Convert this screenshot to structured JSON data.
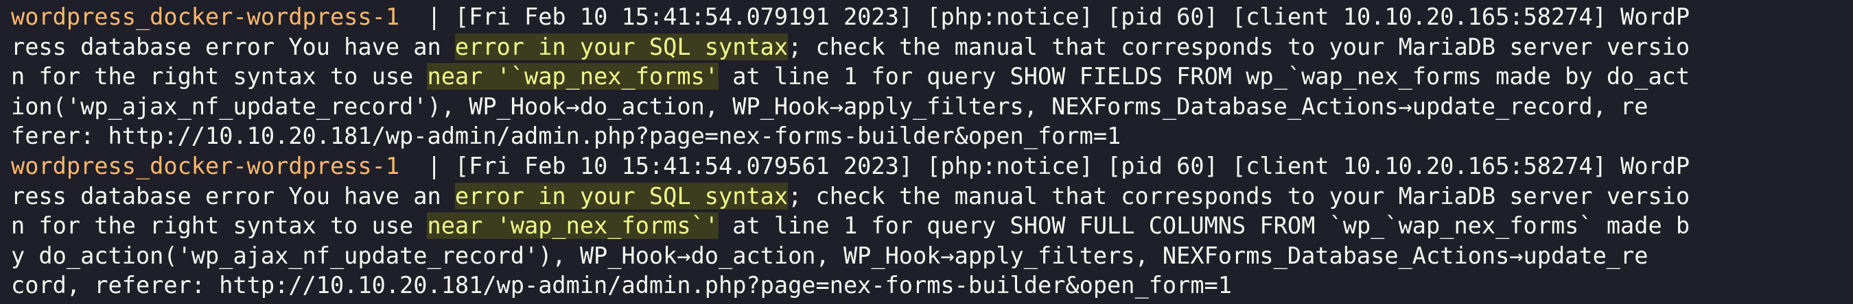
{
  "terminal": {
    "background": "#1e1f29",
    "text_color": "#f8f8f2",
    "container_color": "#ffb86c",
    "highlight_color": "#f1fa8c",
    "highlight_bg": "#3b3d1e",
    "entries": [
      {
        "container": "wordpress_docker-wordpress-1",
        "separator": "  | ",
        "lines": [
          [
            "[Fri Feb 10 15:41:54.079191 2023] [php:notice] [pid 60] [client 10.10.20.165:58274] WordP"
          ],
          [
            "ress database error You have an ",
            "error in your SQL syntax",
            "; check the manual that corresponds to your MariaDB server versio"
          ],
          [
            "n for the right syntax to use ",
            "near '`wap_nex_forms'",
            " at line 1 for query SHOW FIELDS FROM wp_`wap_nex_forms made by do_act"
          ],
          [
            "ion('wp_ajax_nf_update_record'), WP_Hook→do_action, WP_Hook→apply_filters, NEXForms_Database_Actions→update_record, re"
          ],
          [
            "ferer: http://10.10.20.181/wp-admin/admin.php?page=nex-forms-builder&open_form=1"
          ]
        ]
      },
      {
        "container": "wordpress_docker-wordpress-1",
        "separator": "  | ",
        "lines": [
          [
            "[Fri Feb 10 15:41:54.079561 2023] [php:notice] [pid 60] [client 10.10.20.165:58274] WordP"
          ],
          [
            "ress database error You have an ",
            "error in your SQL syntax",
            "; check the manual that corresponds to your MariaDB server versio"
          ],
          [
            "n for the right syntax to use ",
            "near 'wap_nex_forms`'",
            " at line 1 for query SHOW FULL COLUMNS FROM `wp_`wap_nex_forms` made b"
          ],
          [
            "y do_action('wp_ajax_nf_update_record'), WP_Hook→do_action, WP_Hook→apply_filters, NEXForms_Database_Actions→update_re"
          ],
          [
            "cord, referer: http://10.10.20.181/wp-admin/admin.php?page=nex-forms-builder&open_form=1"
          ]
        ]
      }
    ]
  }
}
